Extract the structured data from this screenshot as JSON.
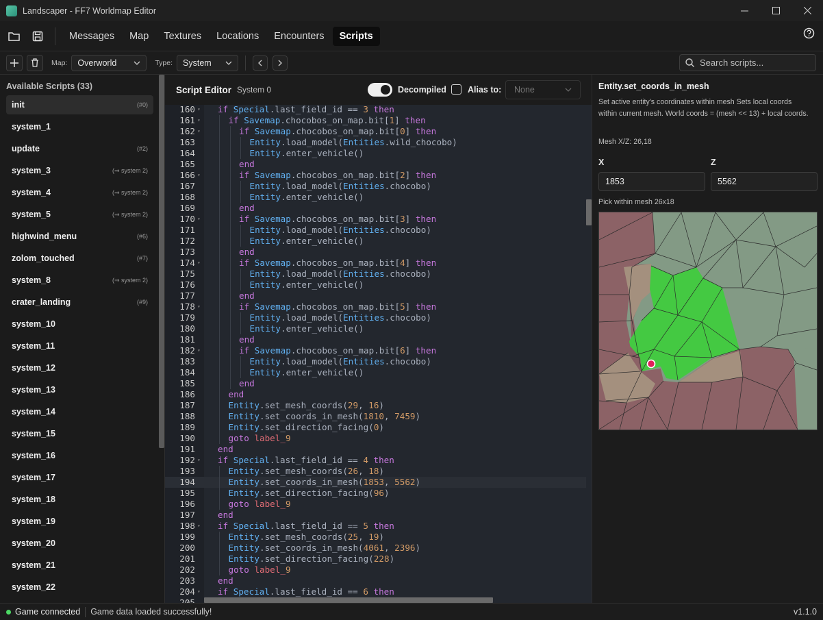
{
  "window": {
    "title": "Landscaper - FF7 Worldmap Editor"
  },
  "tabs": [
    {
      "label": "Messages"
    },
    {
      "label": "Map"
    },
    {
      "label": "Textures"
    },
    {
      "label": "Locations"
    },
    {
      "label": "Encounters"
    },
    {
      "label": "Scripts"
    }
  ],
  "toolbar": {
    "map_label": "Map:",
    "map_value": "Overworld",
    "type_label": "Type:",
    "type_value": "System",
    "search_placeholder": "Search scripts..."
  },
  "sidebar": {
    "title": "Available Scripts (33)",
    "items": [
      {
        "name": "init",
        "badge": "(#0)"
      },
      {
        "name": "system_1",
        "badge": ""
      },
      {
        "name": "update",
        "badge": "(#2)"
      },
      {
        "name": "system_3",
        "badge": "(⇒ system 2)"
      },
      {
        "name": "system_4",
        "badge": "(⇒ system 2)"
      },
      {
        "name": "system_5",
        "badge": "(⇒ system 2)"
      },
      {
        "name": "highwind_menu",
        "badge": "(#6)"
      },
      {
        "name": "zolom_touched",
        "badge": "(#7)"
      },
      {
        "name": "system_8",
        "badge": "(⇒ system 2)"
      },
      {
        "name": "crater_landing",
        "badge": "(#9)"
      },
      {
        "name": "system_10",
        "badge": ""
      },
      {
        "name": "system_11",
        "badge": ""
      },
      {
        "name": "system_12",
        "badge": ""
      },
      {
        "name": "system_13",
        "badge": ""
      },
      {
        "name": "system_14",
        "badge": ""
      },
      {
        "name": "system_15",
        "badge": ""
      },
      {
        "name": "system_16",
        "badge": ""
      },
      {
        "name": "system_17",
        "badge": ""
      },
      {
        "name": "system_18",
        "badge": ""
      },
      {
        "name": "system_19",
        "badge": ""
      },
      {
        "name": "system_20",
        "badge": ""
      },
      {
        "name": "system_21",
        "badge": ""
      },
      {
        "name": "system_22",
        "badge": ""
      }
    ]
  },
  "editor": {
    "title": "Script Editor",
    "subtitle": "System 0",
    "decompiled_label": "Decompiled",
    "alias_label": "Alias to:",
    "alias_value": "None"
  },
  "code_lines": [
    {
      "n": "160",
      "indent": 1,
      "fold": true,
      "text": "if Special.last_field_id == 3 then"
    },
    {
      "n": "161",
      "indent": 2,
      "fold": true,
      "text": "if Savemap.chocobos_on_map.bit[1] then"
    },
    {
      "n": "162",
      "indent": 3,
      "fold": true,
      "text": "if Savemap.chocobos_on_map.bit[0] then"
    },
    {
      "n": "163",
      "indent": 4,
      "fold": false,
      "text": "Entity.load_model(Entities.wild_chocobo)"
    },
    {
      "n": "164",
      "indent": 4,
      "fold": false,
      "text": "Entity.enter_vehicle()"
    },
    {
      "n": "165",
      "indent": 3,
      "fold": false,
      "text": "end"
    },
    {
      "n": "166",
      "indent": 3,
      "fold": true,
      "text": "if Savemap.chocobos_on_map.bit[2] then"
    },
    {
      "n": "167",
      "indent": 4,
      "fold": false,
      "text": "Entity.load_model(Entities.chocobo)"
    },
    {
      "n": "168",
      "indent": 4,
      "fold": false,
      "text": "Entity.enter_vehicle()"
    },
    {
      "n": "169",
      "indent": 3,
      "fold": false,
      "text": "end"
    },
    {
      "n": "170",
      "indent": 3,
      "fold": true,
      "text": "if Savemap.chocobos_on_map.bit[3] then"
    },
    {
      "n": "171",
      "indent": 4,
      "fold": false,
      "text": "Entity.load_model(Entities.chocobo)"
    },
    {
      "n": "172",
      "indent": 4,
      "fold": false,
      "text": "Entity.enter_vehicle()"
    },
    {
      "n": "173",
      "indent": 3,
      "fold": false,
      "text": "end"
    },
    {
      "n": "174",
      "indent": 3,
      "fold": true,
      "text": "if Savemap.chocobos_on_map.bit[4] then"
    },
    {
      "n": "175",
      "indent": 4,
      "fold": false,
      "text": "Entity.load_model(Entities.chocobo)"
    },
    {
      "n": "176",
      "indent": 4,
      "fold": false,
      "text": "Entity.enter_vehicle()"
    },
    {
      "n": "177",
      "indent": 3,
      "fold": false,
      "text": "end"
    },
    {
      "n": "178",
      "indent": 3,
      "fold": true,
      "text": "if Savemap.chocobos_on_map.bit[5] then"
    },
    {
      "n": "179",
      "indent": 4,
      "fold": false,
      "text": "Entity.load_model(Entities.chocobo)"
    },
    {
      "n": "180",
      "indent": 4,
      "fold": false,
      "text": "Entity.enter_vehicle()"
    },
    {
      "n": "181",
      "indent": 3,
      "fold": false,
      "text": "end"
    },
    {
      "n": "182",
      "indent": 3,
      "fold": true,
      "text": "if Savemap.chocobos_on_map.bit[6] then"
    },
    {
      "n": "183",
      "indent": 4,
      "fold": false,
      "text": "Entity.load_model(Entities.chocobo)"
    },
    {
      "n": "184",
      "indent": 4,
      "fold": false,
      "text": "Entity.enter_vehicle()"
    },
    {
      "n": "185",
      "indent": 3,
      "fold": false,
      "text": "end"
    },
    {
      "n": "186",
      "indent": 2,
      "fold": false,
      "text": "end"
    },
    {
      "n": "187",
      "indent": 2,
      "fold": false,
      "text": "Entity.set_mesh_coords(29, 16)"
    },
    {
      "n": "188",
      "indent": 2,
      "fold": false,
      "text": "Entity.set_coords_in_mesh(1810, 7459)"
    },
    {
      "n": "189",
      "indent": 2,
      "fold": false,
      "text": "Entity.set_direction_facing(0)"
    },
    {
      "n": "190",
      "indent": 2,
      "fold": false,
      "text": "goto label_9"
    },
    {
      "n": "191",
      "indent": 1,
      "fold": false,
      "text": "end"
    },
    {
      "n": "192",
      "indent": 1,
      "fold": true,
      "text": "if Special.last_field_id == 4 then"
    },
    {
      "n": "193",
      "indent": 2,
      "fold": false,
      "text": "Entity.set_mesh_coords(26, 18)"
    },
    {
      "n": "194",
      "indent": 2,
      "fold": false,
      "text": "Entity.set_coords_in_mesh(1853, 5562)"
    },
    {
      "n": "195",
      "indent": 2,
      "fold": false,
      "text": "Entity.set_direction_facing(96)"
    },
    {
      "n": "196",
      "indent": 2,
      "fold": false,
      "text": "goto label_9"
    },
    {
      "n": "197",
      "indent": 1,
      "fold": false,
      "text": "end"
    },
    {
      "n": "198",
      "indent": 1,
      "fold": true,
      "text": "if Special.last_field_id == 5 then"
    },
    {
      "n": "199",
      "indent": 2,
      "fold": false,
      "text": "Entity.set_mesh_coords(25, 19)"
    },
    {
      "n": "200",
      "indent": 2,
      "fold": false,
      "text": "Entity.set_coords_in_mesh(4061, 2396)"
    },
    {
      "n": "201",
      "indent": 2,
      "fold": false,
      "text": "Entity.set_direction_facing(228)"
    },
    {
      "n": "202",
      "indent": 2,
      "fold": false,
      "text": "goto label_9"
    },
    {
      "n": "203",
      "indent": 1,
      "fold": false,
      "text": "end"
    },
    {
      "n": "204",
      "indent": 1,
      "fold": true,
      "text": "if Special.last_field_id == 6 then"
    },
    {
      "n": "205",
      "indent": 2,
      "fold": false,
      "text": ""
    }
  ],
  "current_line": "194",
  "right_panel": {
    "title": "Entity.set_coords_in_mesh",
    "description": "Set active entity's coordinates within mesh Sets local coords within current mesh. World coords = (mesh << 13) + local coords.",
    "mesh_xz": "Mesh X/Z: 26,18",
    "x_label": "X",
    "z_label": "Z",
    "x_value": "1853",
    "z_value": "5562",
    "pick_label": "Pick within mesh 26x18"
  },
  "status": {
    "connection": "Game connected",
    "message": "Game data loaded successfully!",
    "version": "v1.1.0"
  },
  "colors": {
    "accent_green": "#4cd964",
    "terrain_green": "#44c942",
    "terrain_grey_green": "#839a85",
    "terrain_red": "#8c6266",
    "terrain_tan": "#a4907e",
    "marker": "#e0205a"
  }
}
